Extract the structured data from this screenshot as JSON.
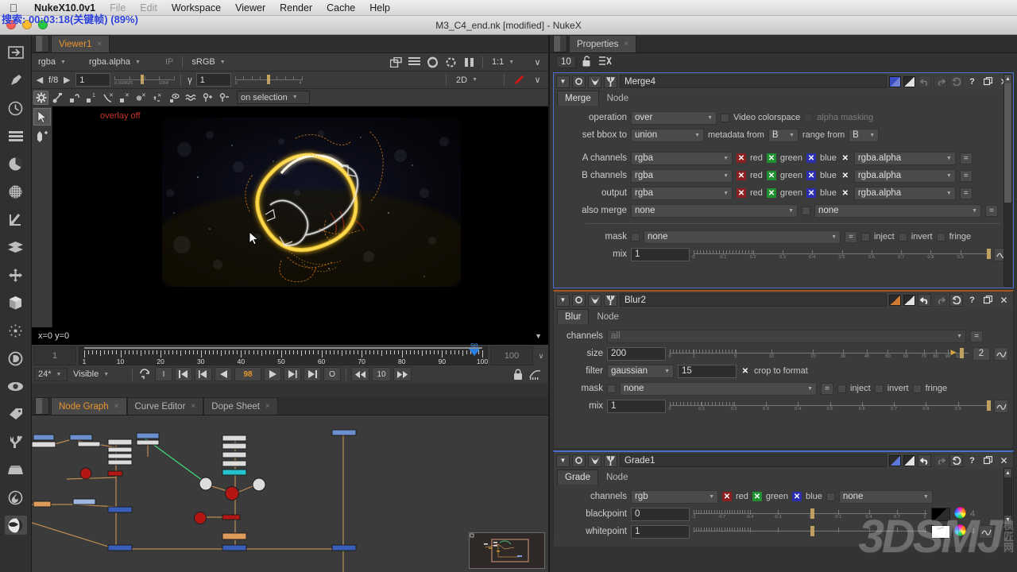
{
  "macbar": {
    "apple_icon": "apple-icon",
    "items": [
      {
        "label": "NukeX10.0v1",
        "bold": true
      },
      {
        "label": "File",
        "dim": true
      },
      {
        "label": "Edit",
        "dim": true
      },
      {
        "label": "Workspace",
        "dim": false
      },
      {
        "label": "Viewer",
        "dim": false
      },
      {
        "label": "Render",
        "dim": false
      },
      {
        "label": "Cache",
        "dim": false
      },
      {
        "label": "Help",
        "dim": false
      }
    ]
  },
  "recording_overlay": "搜索: 00:03:18(关键帧) (89%)",
  "titlebar": {
    "title": "M3_C4_end.nk [modified] - NukeX"
  },
  "rail": {
    "items": [
      {
        "name": "image-icon"
      },
      {
        "name": "draw-icon"
      },
      {
        "name": "time-icon"
      },
      {
        "name": "channel-icon"
      },
      {
        "name": "color-icon"
      },
      {
        "name": "filter-icon"
      },
      {
        "name": "keyer-icon"
      },
      {
        "name": "merge-icon"
      },
      {
        "name": "transform-icon"
      },
      {
        "name": "3d-icon"
      },
      {
        "name": "particles-icon"
      },
      {
        "name": "deep-icon"
      },
      {
        "name": "views-icon"
      },
      {
        "name": "metadata-icon"
      },
      {
        "name": "toolsets-icon"
      },
      {
        "name": "other-icon"
      },
      {
        "name": "furnace-icon"
      },
      {
        "name": "ocula-icon"
      }
    ],
    "selected_index": 17
  },
  "viewer": {
    "tab": {
      "label": "Viewer1",
      "close": "×"
    },
    "row1": {
      "channels": "rgba",
      "layer": "rgba.alpha",
      "ip_label": "IP",
      "colorspace": "sRGB",
      "zoom": "1:1",
      "icons": [
        "roi-icon",
        "list-icon",
        "refresh-icon",
        "proxy-icon",
        "pause-icon"
      ]
    },
    "row2": {
      "exposure_label": "f/8",
      "exposure_value": "1",
      "exposure_ticks": [
        "0.018625",
        "1",
        "1064"
      ],
      "gamma_label": "γ",
      "gamma_value": "1",
      "gamma_ticks": [
        "0",
        "1",
        "4"
      ],
      "view_mode": "2D"
    },
    "row3": {
      "icons": [
        "gear-icon",
        "bezier-icon",
        "lock-point-icon",
        "point-1-icon",
        "curve-x-icon",
        "point-x-icon",
        "transform-x-icon",
        "feather-x-icon",
        "visibility-icon",
        "ripple-icon",
        "add-point-icon",
        "remove-point-icon"
      ],
      "apply_to": "on selection"
    },
    "left_tools": [
      "select-arrow-icon",
      "add-points-icon"
    ],
    "overlay_text": "overlay off",
    "info_bar": {
      "coords": "x=0 y=0",
      "caret": "chevron-down-icon"
    }
  },
  "timeline": {
    "start_frame": "1",
    "end_frame": "100",
    "current_frame": "98",
    "playhead_label": "98",
    "ruler_labels": [
      "1",
      "10",
      "20",
      "30",
      "40",
      "50",
      "60",
      "70",
      "80",
      "90",
      "100"
    ],
    "fps": "24*",
    "visibility": "Visible",
    "increment": "10",
    "buttons": [
      "sync-icon",
      "I",
      "first-frame-icon",
      "prev-keyframe-icon",
      "step-back-icon",
      "play-forward-icon",
      "step-forward-icon",
      "last-frame-icon",
      "O",
      "back-10-icon",
      "forward-10-icon"
    ],
    "right_icons": [
      "lock-icon",
      "key-curve-icon"
    ]
  },
  "nodegraph": {
    "tabs": [
      {
        "label": "Node Graph",
        "active": true
      },
      {
        "label": "Curve Editor",
        "active": false
      },
      {
        "label": "Dope Sheet",
        "active": false
      }
    ]
  },
  "properties": {
    "tab": {
      "label": "Properties",
      "close": "×"
    },
    "toolbar": {
      "count": "10",
      "lock_icon": "unlock-icon",
      "clear_icon": "clear-all-icon"
    },
    "nodes": [
      {
        "id": "merge4",
        "title": "Merge4",
        "selected": true,
        "accent": "#4b6fd1",
        "tabs": [
          {
            "label": "Merge",
            "active": true
          },
          {
            "label": "Node",
            "active": false
          }
        ],
        "header_swatch_a": "#3a4fc4",
        "rows": {
          "operation_label": "operation",
          "operation_value": "over",
          "video_colorspace_label": "Video colorspace",
          "alpha_masking_label": "alpha masking",
          "set_bbox_label": "set bbox to",
          "set_bbox_value": "union",
          "metadata_from_label": "metadata from",
          "metadata_from_value": "B",
          "range_from_label": "range from",
          "range_from_value": "B",
          "channel_rows": [
            {
              "label": "A channels",
              "value": "rgba",
              "alpha": "rgba.alpha"
            },
            {
              "label": "B channels",
              "value": "rgba",
              "alpha": "rgba.alpha"
            },
            {
              "label": "output",
              "value": "rgba",
              "alpha": "rgba.alpha"
            }
          ],
          "rgb_labels": [
            "red",
            "green",
            "blue"
          ],
          "also_merge_label": "also merge",
          "also_merge_value": "none",
          "also_merge_value2": "none",
          "mask_label": "mask",
          "mask_value": "none",
          "inject_label": "inject",
          "invert_label": "invert",
          "fringe_label": "fringe",
          "mix_label": "mix",
          "mix_value": "1",
          "mix_ticks": [
            "0",
            "0.1",
            "0.2",
            "0.3",
            "0.4",
            "0.5",
            "0.6",
            "0.7",
            "0.8",
            "0.9",
            "1"
          ]
        }
      },
      {
        "id": "blur2",
        "title": "Blur2",
        "selected": false,
        "accent": "#d07b33",
        "tabs": [
          {
            "label": "Blur",
            "active": true
          },
          {
            "label": "Node",
            "active": false
          }
        ],
        "rows": {
          "channels_label": "channels",
          "channels_value": "all",
          "size_label": "size",
          "size_value": "200",
          "size_ticks": [
            "0",
            "1",
            "5",
            "10",
            "20",
            "30",
            "40",
            "50",
            "60",
            "70",
            "80",
            "90",
            "100"
          ],
          "size_badge": "2",
          "filter_label": "filter",
          "filter_value": "gaussian",
          "filter_quality": "15",
          "crop_to_format_label": "crop to format",
          "mask_label": "mask",
          "mask_value": "none",
          "inject_label": "inject",
          "invert_label": "invert",
          "fringe_label": "fringe",
          "mix_label": "mix",
          "mix_value": "1",
          "mix_ticks": [
            "0",
            "0.1",
            "0.2",
            "0.3",
            "0.4",
            "0.5",
            "0.6",
            "0.7",
            "0.8",
            "0.9",
            "1"
          ]
        }
      },
      {
        "id": "grade1",
        "title": "Grade1",
        "selected": false,
        "accent": "#4b6fd1",
        "tabs": [
          {
            "label": "Grade",
            "active": true
          },
          {
            "label": "Node",
            "active": false
          }
        ],
        "rows": {
          "channels_label": "channels",
          "channels_value": "rgb",
          "rgb_labels": [
            "red",
            "green",
            "blue"
          ],
          "mask_value": "none",
          "blackpoint_label": "blackpoint",
          "blackpoint_value": "0",
          "blackpoint_ticks": [
            "-1",
            "-0.7",
            "-0.4",
            "-0.1",
            "0",
            "0.1",
            "0.4",
            "0.7",
            "1"
          ],
          "blackpoint_badge": "4",
          "whitepoint_label": "whitepoint",
          "whitepoint_value": "1",
          "whitepoint_badge": "4"
        }
      }
    ]
  },
  "watermark": {
    "text": "3DSMJ",
    "cn_lines": [
      "模",
      "匠",
      "网"
    ]
  },
  "colors": {
    "accent_orange": "#e8962e",
    "accent_blue": "#4b6fd1",
    "panel_bg": "#3b3b3b",
    "window_bg": "#333333",
    "node_wire": "#c08b52"
  }
}
